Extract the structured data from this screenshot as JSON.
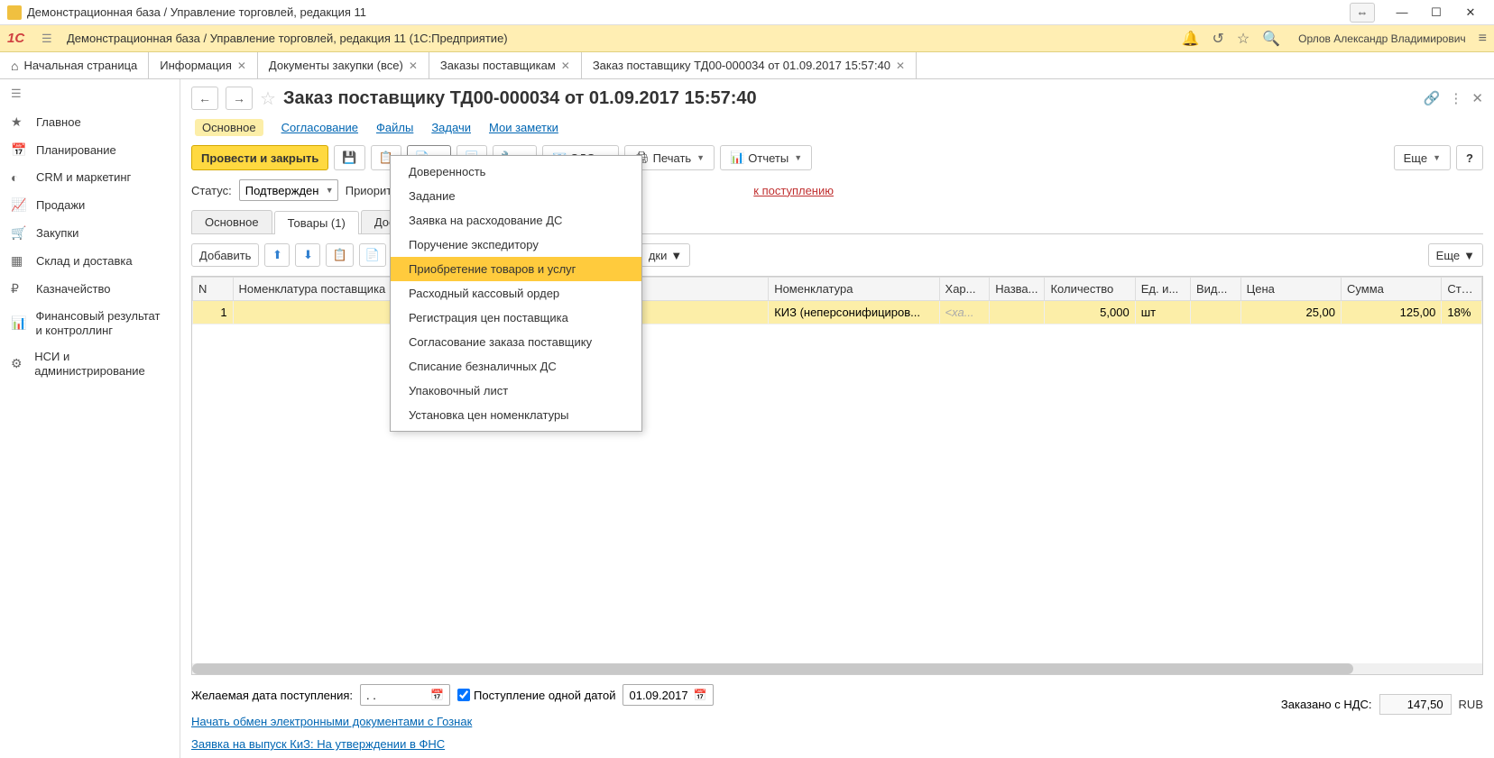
{
  "window": {
    "title": "Демонстрационная база / Управление торговлей, редакция 11"
  },
  "app_header": {
    "logo_text": "1C",
    "subtitle": "Демонстрационная база / Управление торговлей, редакция 11  (1С:Предприятие)",
    "user": "Орлов Александр Владимирович"
  },
  "tabs": [
    {
      "label": "Начальная страница",
      "closable": false,
      "home": true
    },
    {
      "label": "Информация",
      "closable": true
    },
    {
      "label": "Документы закупки (все)",
      "closable": true
    },
    {
      "label": "Заказы поставщикам",
      "closable": true
    },
    {
      "label": "Заказ поставщику ТД00-000034 от 01.09.2017 15:57:40",
      "closable": true,
      "active": true
    }
  ],
  "sidebar": [
    {
      "icon": "★",
      "label": "Главное"
    },
    {
      "icon": "📅",
      "label": "Планирование"
    },
    {
      "icon": "◐",
      "label": "CRM и маркетинг"
    },
    {
      "icon": "📈",
      "label": "Продажи"
    },
    {
      "icon": "🛒",
      "label": "Закупки"
    },
    {
      "icon": "▦",
      "label": "Склад и доставка"
    },
    {
      "icon": "₽",
      "label": "Казначейство"
    },
    {
      "icon": "📊",
      "label": "Финансовый результат и контроллинг"
    },
    {
      "icon": "⚙",
      "label": "НСИ и администрирование"
    }
  ],
  "doc": {
    "title": "Заказ поставщику ТД00-000034 от 01.09.2017 15:57:40"
  },
  "section_tabs": [
    "Основное",
    "Согласование",
    "Файлы",
    "Задачи",
    "Мои заметки"
  ],
  "toolbar": {
    "post_close": "Провести и закрыть",
    "edo": "ЭДО",
    "print": "Печать",
    "reports": "Отчеты",
    "more": "Еще"
  },
  "status": {
    "label": "Статус:",
    "value": "Подтвержден",
    "priority_label": "Приорит",
    "link": "к поступлению"
  },
  "sub_tabs": [
    "Основное",
    "Товары (1)",
    "Доставка"
  ],
  "table_toolbar": {
    "add": "Добавить",
    "discounts": "дки",
    "more": "Еще"
  },
  "table": {
    "columns": [
      "N",
      "Номенклатура поставщика",
      "Номенклатура",
      "Хар...",
      "Назва...",
      "Количество",
      "Ед. и...",
      "Вид...",
      "Цена",
      "Сумма",
      "Ста..."
    ],
    "rows": [
      {
        "n": "1",
        "nomp": "",
        "nom": "КИЗ (неперсонифициров...",
        "har": "<ха...",
        "naz": "",
        "qty": "5,000",
        "unit": "шт",
        "vid": "",
        "price": "25,00",
        "sum": "125,00",
        "vat": "18%"
      }
    ]
  },
  "dropdown": {
    "items": [
      "Доверенность",
      "Задание",
      "Заявка на расходование ДС",
      "Поручение экспедитору",
      "Приобретение товаров и услуг",
      "Расходный кассовый ордер",
      "Регистрация цен поставщика",
      "Согласование заказа поставщику",
      "Списание безналичных ДС",
      "Упаковочный лист",
      "Установка цен номенклатуры"
    ],
    "highlight_index": 4
  },
  "footer": {
    "desired_date_label": "Желаемая дата поступления:",
    "desired_date_value": "  .  .",
    "single_date_checkbox": "Поступление одной датой",
    "single_date_value": "01.09.2017",
    "link1": "Начать обмен электронными документами с Гознак",
    "link2": "Заявка на выпуск КиЗ: На утверждении в ФНС",
    "totals_label": "Заказано с НДС:",
    "totals_value": "147,50",
    "currency": "RUB"
  }
}
